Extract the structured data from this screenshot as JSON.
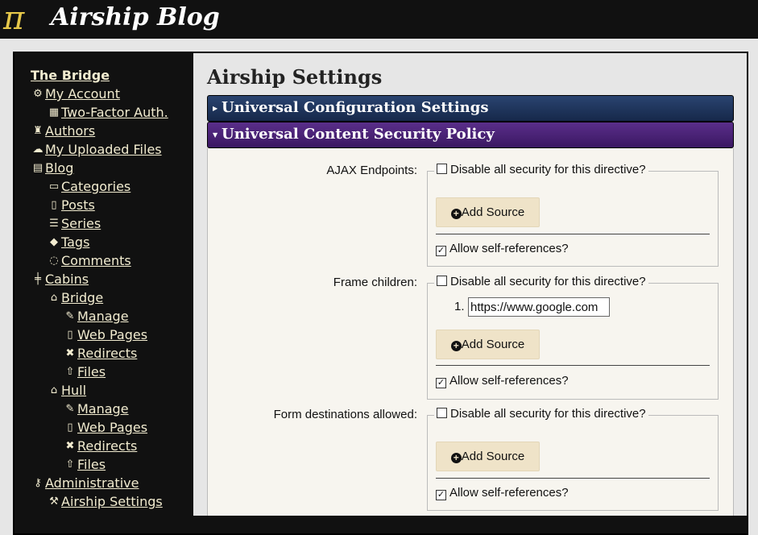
{
  "header": {
    "logo_glyph": "π",
    "title": "Airship Blog"
  },
  "sidebar": {
    "items": [
      {
        "label": "The Bridge",
        "icon": ""
      },
      {
        "label": "My Account",
        "icon": "gear-icon"
      },
      {
        "label": "Two-Factor Auth.",
        "icon": "qrcode-icon"
      },
      {
        "label": "Authors",
        "icon": "user-secret-icon"
      },
      {
        "label": "My Uploaded Files",
        "icon": "cloud-upload-icon"
      },
      {
        "label": "Blog",
        "icon": "book-icon"
      },
      {
        "label": "Categories",
        "icon": "folder-open-icon"
      },
      {
        "label": "Posts",
        "icon": "file-text-icon"
      },
      {
        "label": "Series",
        "icon": "list-alt-icon"
      },
      {
        "label": "Tags",
        "icon": "tags-icon"
      },
      {
        "label": "Comments",
        "icon": "comment-icon"
      },
      {
        "label": "Cabins",
        "icon": "signpost-icon"
      },
      {
        "label": "Bridge",
        "icon": "home-icon"
      },
      {
        "label": "Manage",
        "icon": "edit-icon"
      },
      {
        "label": "Web Pages",
        "icon": "file-code-icon"
      },
      {
        "label": "Redirects",
        "icon": "arrows-icon"
      },
      {
        "label": "Files",
        "icon": "upload-icon"
      },
      {
        "label": "Hull",
        "icon": "home-icon"
      },
      {
        "label": "Manage",
        "icon": "edit-icon"
      },
      {
        "label": "Web Pages",
        "icon": "file-code-icon"
      },
      {
        "label": "Redirects",
        "icon": "arrows-icon"
      },
      {
        "label": "Files",
        "icon": "upload-icon"
      },
      {
        "label": "Administrative",
        "icon": "key-icon"
      },
      {
        "label": "Airship Settings",
        "icon": "wrench-icon"
      }
    ]
  },
  "main": {
    "title": "Airship Settings",
    "sections": [
      {
        "label": "Universal Configuration Settings",
        "expanded": false
      },
      {
        "label": "Universal Content Security Policy",
        "expanded": true
      }
    ],
    "csp": {
      "disable_label": "Disable all security for this directive?",
      "add_source_label": "Add Source",
      "self_ref_label": "Allow self-references?",
      "directives": [
        {
          "label": "AJAX Endpoints:",
          "disable_checked": false,
          "self_checked": true,
          "sources": []
        },
        {
          "label": "Frame children:",
          "disable_checked": false,
          "self_checked": true,
          "sources": [
            {
              "num": "1.",
              "value": "https://www.google.com"
            }
          ]
        },
        {
          "label": "Form destinations allowed:",
          "disable_checked": false,
          "self_checked": true,
          "sources": []
        }
      ]
    }
  },
  "colors": {
    "header_bg": "#111111",
    "sidebar_text": "#f2ecd0",
    "section_blue": "#1f3560",
    "section_purple": "#4a2276",
    "button_bg": "#efe3c8"
  }
}
